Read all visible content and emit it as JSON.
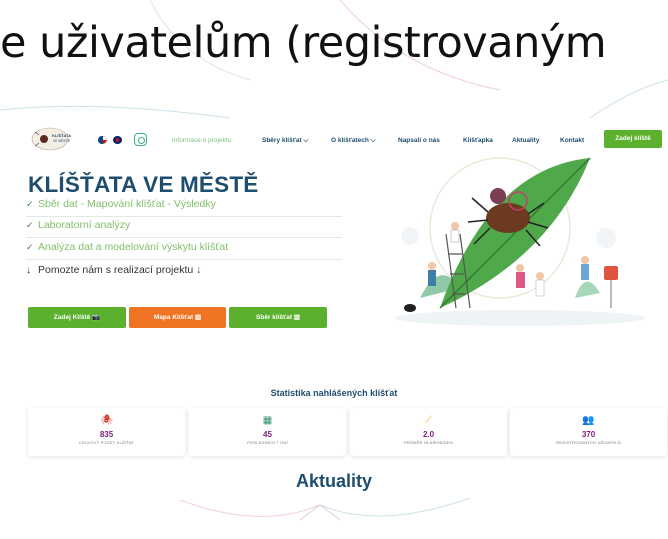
{
  "caption": {
    "text": "e uživatelům (registrovaným"
  },
  "nav": {
    "logo": "KLÍŠŤATA VE MĚSTĚ",
    "flags": [
      "cz-flag-icon",
      "uk-flag-icon"
    ],
    "instagram_icon": "instagram-icon",
    "links": [
      {
        "label": "Informace o projektu"
      },
      {
        "label": "Sběry klíšťat ⌵"
      },
      {
        "label": "O klíšťatech ⌵"
      },
      {
        "label": "Napsali o nás"
      },
      {
        "label": "Klíšťapka"
      },
      {
        "label": "Aktuality"
      },
      {
        "label": "Kontakt"
      }
    ],
    "cta": "Zadej klíště"
  },
  "hero": {
    "title": "KLÍŠŤATA VE MĚSTĚ",
    "items": [
      {
        "check": "✓",
        "text": "Sběr dat - Mapování klíšťat - Výsledky"
      },
      {
        "check": "✓",
        "text": "Laboratorní analýzy"
      },
      {
        "check": "✓",
        "text": "Analýza dat a modelování výskytu klíšťat"
      },
      {
        "check": "↓",
        "text": "Pomozte nám s realizací projektu ↓"
      }
    ],
    "buttons": [
      {
        "label": "Zadej Klíště 📷"
      },
      {
        "label": "Mapa Klíšťat ▥"
      },
      {
        "label": "Sběr klíšťat ▥"
      }
    ],
    "colors": {
      "primary": "#1e4d6e",
      "green": "#5bb02d",
      "orange": "#f07324",
      "check_text": "#82c06c"
    }
  },
  "stats": {
    "title": "Statistika nahlášených klíšťat",
    "cards": [
      {
        "icon": "tick-icon",
        "glyph": "🕷",
        "value": "835",
        "label": "CELKOVÝ POČET KLÍŠŤAT",
        "color": "#d23a2c"
      },
      {
        "icon": "calendar-icon",
        "glyph": "▦",
        "value": "45",
        "label": "POSLEDNÍCH 7 DNÍ",
        "color": "#2f8f6b"
      },
      {
        "icon": "chart-icon",
        "glyph": "⟋",
        "value": "2.0",
        "label": "PRŮMĚR HLÁŠENÍ/DEN",
        "color": "#e0b51d"
      },
      {
        "icon": "users-icon",
        "glyph": "👥",
        "value": "370",
        "label": "REGISTROVANÝCH UŽIVATELŮ",
        "color": "#7a4ca8"
      }
    ]
  },
  "news": {
    "title": "Aktuality"
  }
}
